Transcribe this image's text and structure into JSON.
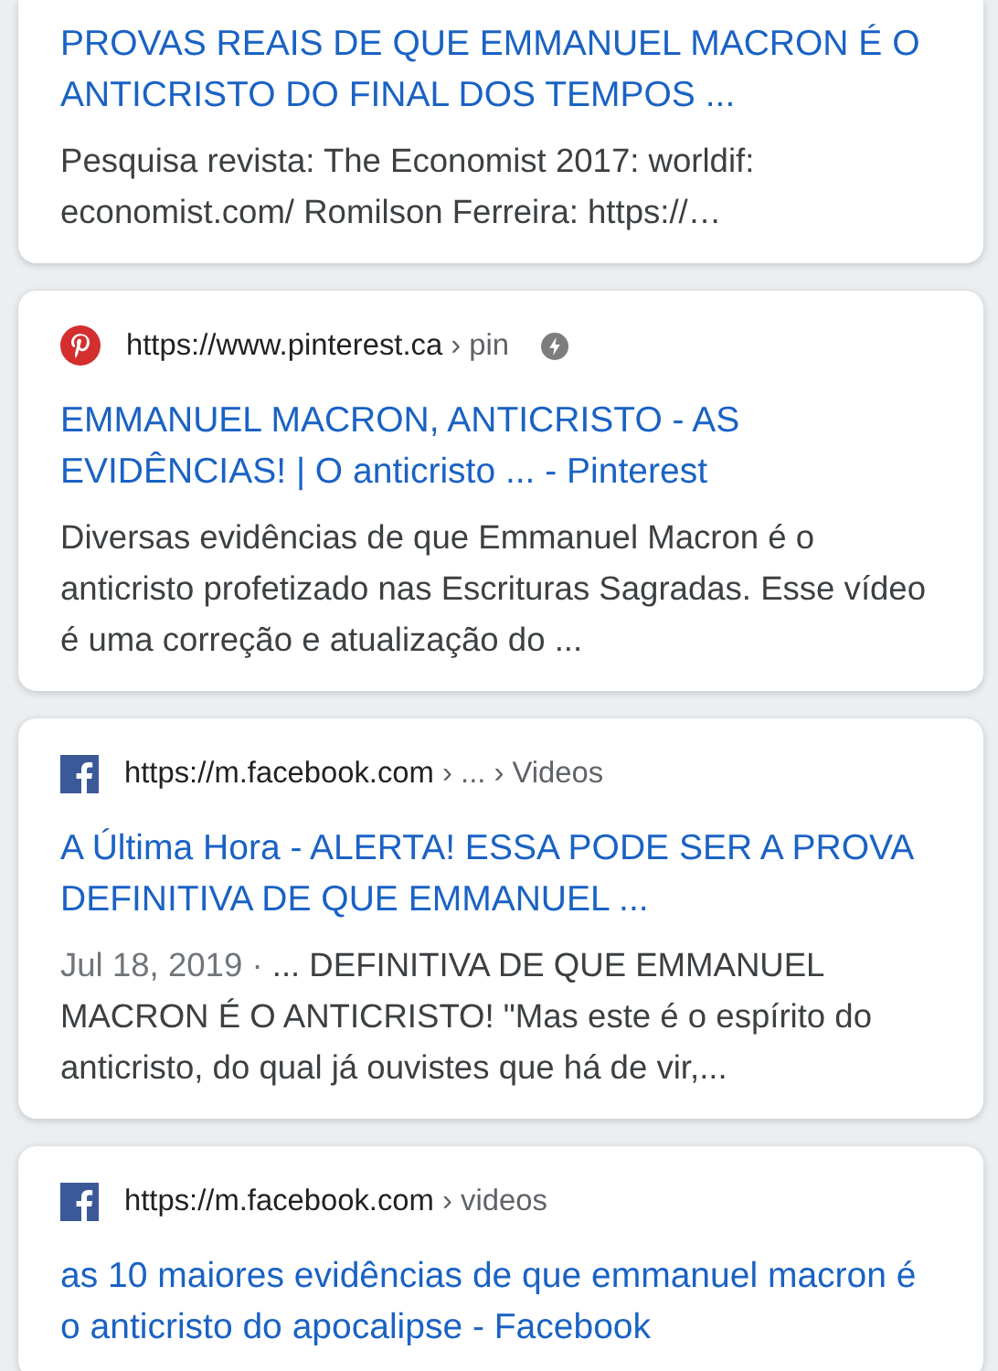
{
  "results": [
    {
      "cut_top": true,
      "title": "PROVAS REAIS DE QUE EMMANUEL MACRON É O ANTICRISTO DO FINAL DOS TEMPOS ...",
      "snippet": "Pesquisa revista: The Economist 2017: worldif: economist.com/ Romilson Ferreira: https://…"
    },
    {
      "cut_top": false,
      "source": {
        "kind": "pinterest",
        "url": "https://www.pinterest.ca",
        "path": " › pin",
        "amp": true
      },
      "title": "EMMANUEL MACRON, ANTICRISTO - AS EVIDÊNCIAS! | O anticristo ... - Pinterest",
      "snippet": "Diversas evidências de que Emmanuel Macron é o anticristo profetizado nas Escrituras Sagradas. Esse vídeo é uma correção e atualização do ..."
    },
    {
      "cut_top": false,
      "source": {
        "kind": "facebook",
        "url": "https://m.facebook.com",
        "path": " › ... › Videos",
        "amp": false
      },
      "title": "A Última Hora - ALERTA! ESSA PODE SER A PROVA DEFINITIVA DE QUE EMMANUEL ...",
      "date": "Jul 18, 2019 · ",
      "snippet": "... DEFINITIVA DE QUE EMMANUEL MACRON É O ANTICRISTO! \"Mas este é o espírito do anticristo, do qual já ouvistes que há de vir,..."
    },
    {
      "cut_top": false,
      "source": {
        "kind": "facebook",
        "url": "https://m.facebook.com",
        "path": " › videos",
        "amp": false
      },
      "title": "as 10 maiores evidências de que emmanuel macron é o anticristo do apocalipse - Facebook"
    }
  ]
}
